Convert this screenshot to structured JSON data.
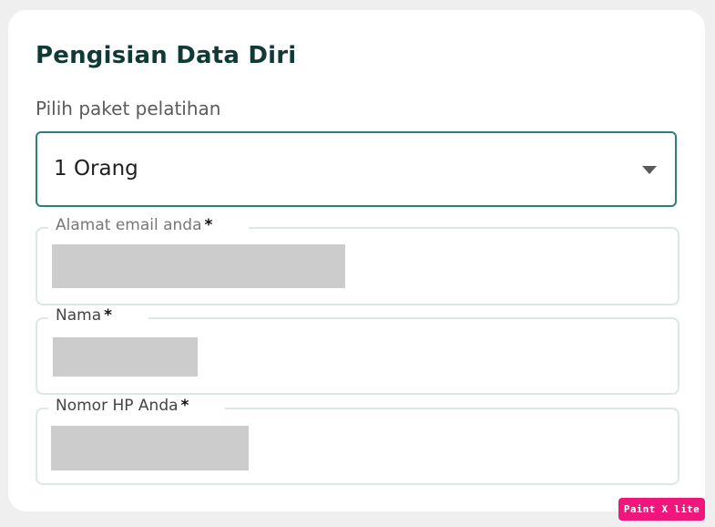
{
  "form": {
    "title": "Pengisian Data Diri",
    "package_label": "Pilih paket pelatihan",
    "package_value": "1 Orang",
    "email_label": "Alamat email anda",
    "name_label": "Nama",
    "phone_label": "Nomor HP Anda",
    "required_mark": "*"
  },
  "icons": {
    "dropdown": "chevron-down-icon"
  },
  "badge": {
    "text": "Paint X lite"
  },
  "colors": {
    "title": "#0f3a36",
    "select_border": "#2d7f7a",
    "field_border": "#dbe8e6",
    "badge": "#f0167b"
  }
}
